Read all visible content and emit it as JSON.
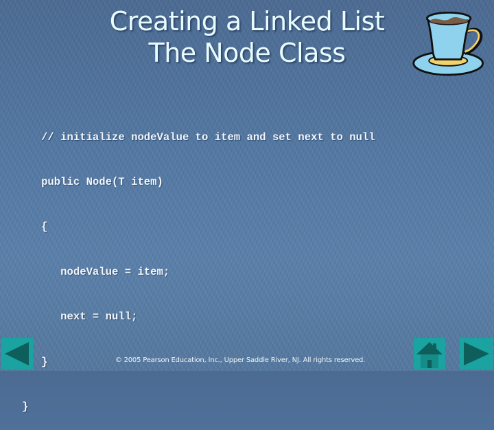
{
  "slide": {
    "title_lines": [
      "Creating a Linked List",
      "The Node Class"
    ],
    "code_lines": [
      "   // initialize nodeValue to item and set next to null",
      "   public Node(T item)",
      "   {",
      "      nodeValue = item;",
      "      next = null;",
      "   }",
      "}"
    ],
    "footer": "© 2005 Pearson Education, Inc., Upper Saddle River, NJ.  All rights reserved."
  },
  "icons": {
    "decoration": "coffee-cup-icon",
    "prev": "left-triangle-icon",
    "home": "home-icon",
    "next": "right-triangle-icon"
  },
  "colors": {
    "background": "#5378a3",
    "title": "#e8fbff",
    "code": "#f2f6fa",
    "nav_button": "#1aa3a0",
    "nav_glyph": "#0e5f5c"
  }
}
